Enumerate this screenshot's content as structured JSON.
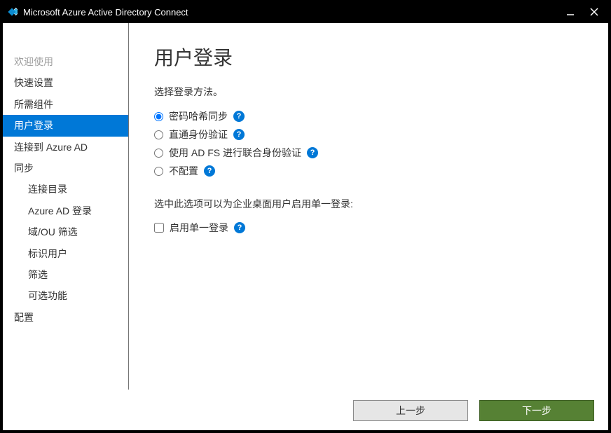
{
  "titlebar": {
    "title": "Microsoft Azure Active Directory Connect"
  },
  "sidebar": {
    "items": [
      {
        "label": "欢迎使用",
        "state": "disabled",
        "indent": false
      },
      {
        "label": "快速设置",
        "state": "normal",
        "indent": false
      },
      {
        "label": "所需组件",
        "state": "normal",
        "indent": false
      },
      {
        "label": "用户登录",
        "state": "active",
        "indent": false
      },
      {
        "label": "连接到 Azure AD",
        "state": "normal",
        "indent": false
      },
      {
        "label": "同步",
        "state": "normal",
        "indent": false
      },
      {
        "label": "连接目录",
        "state": "normal",
        "indent": true
      },
      {
        "label": "Azure AD 登录",
        "state": "normal",
        "indent": true
      },
      {
        "label": "域/OU 筛选",
        "state": "normal",
        "indent": true
      },
      {
        "label": "标识用户",
        "state": "normal",
        "indent": true
      },
      {
        "label": "筛选",
        "state": "normal",
        "indent": true
      },
      {
        "label": "可选功能",
        "state": "normal",
        "indent": true
      },
      {
        "label": "配置",
        "state": "normal",
        "indent": false
      }
    ]
  },
  "main": {
    "title": "用户登录",
    "instruction": "选择登录方法。",
    "options": [
      {
        "label": "密码哈希同步",
        "selected": true
      },
      {
        "label": "直通身份验证",
        "selected": false
      },
      {
        "label": "使用 AD FS 进行联合身份验证",
        "selected": false
      },
      {
        "label": "不配置",
        "selected": false
      }
    ],
    "sso_desc": "选中此选项可以为企业桌面用户启用单一登录:",
    "sso_checkbox_label": "启用单一登录",
    "sso_checked": false
  },
  "footer": {
    "prev": "上一步",
    "next": "下一步"
  }
}
